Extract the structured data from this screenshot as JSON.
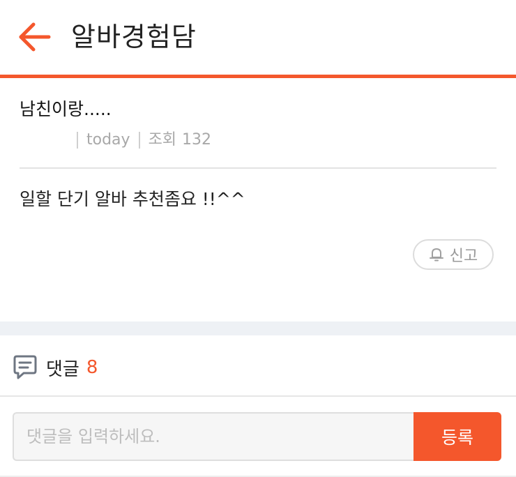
{
  "header": {
    "back_icon": "arrow-left-icon",
    "title": "알바경험담",
    "accent_color": "#f4572c"
  },
  "post": {
    "title": "남친이랑.....",
    "date": "today",
    "views_label": "조회",
    "views_count": "132",
    "body": "일할 단기 알바 추천좀요 !!^^",
    "report_icon": "bell-icon",
    "report_label": "신고"
  },
  "comments": {
    "icon": "comment-icon",
    "label": "댓글",
    "count": "8",
    "input_placeholder": "댓글을 입력하세요.",
    "input_value": "",
    "submit_label": "등록"
  }
}
